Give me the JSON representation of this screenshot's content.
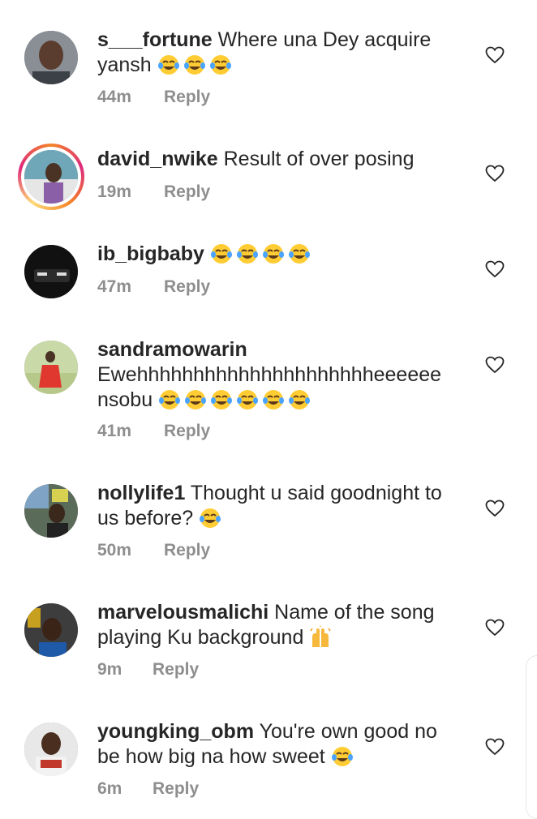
{
  "reply_label": "Reply",
  "comments": [
    {
      "username": "s___fortune",
      "text": "Where una Dey acquire yansh",
      "emoji_count": 3,
      "emoji": "face-with-tears-of-joy",
      "time": "44m"
    },
    {
      "username": "david_nwike",
      "text": "Result of over posing",
      "emoji_count": 0,
      "time": "19m",
      "has_story": true
    },
    {
      "username": "ib_bigbaby",
      "text": "",
      "emoji_count": 4,
      "emoji": "face-with-tears-of-joy",
      "time": "47m"
    },
    {
      "username": "sandramowarin",
      "text": "Ewehhhhhhhhhhhhhhhhhhhhheeeeee nsobu",
      "emoji_count": 6,
      "emoji": "face-with-tears-of-joy",
      "time": "41m"
    },
    {
      "username": "nollylife1",
      "text": "Thought u said goodnight to us before?",
      "emoji_count": 1,
      "emoji": "face-with-tears-of-joy",
      "time": "50m"
    },
    {
      "username": "marvelousmalichi",
      "text": "Name of the song playing Ku background",
      "emoji_count": 1,
      "emoji": "raising-hands",
      "time": "9m"
    },
    {
      "username": "youngking_obm",
      "text": "You're own good no be how big na how sweet",
      "emoji_count": 1,
      "emoji": "face-with-tears-of-joy",
      "time": "6m"
    }
  ],
  "colors": {
    "text": "#262626",
    "meta": "#8e8e8e",
    "heart_outline": "#262626"
  },
  "icons": {
    "like": "heart-outline-icon"
  }
}
